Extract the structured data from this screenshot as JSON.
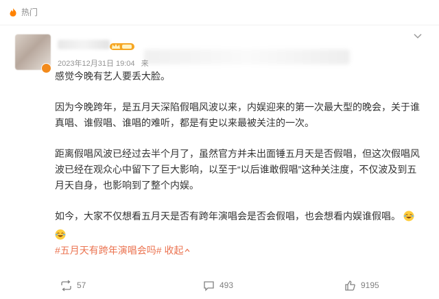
{
  "header": {
    "section_label": "热门"
  },
  "post": {
    "timestamp": "2023年12月31日 19:04",
    "source_prefix": "来",
    "paragraphs": [
      "感觉今晚有艺人要丢大脸。",
      "因为今晚跨年，是五月天深陷假唱风波以来，内娱迎来的第一次最大型的晚会，关于谁真唱、谁假唱、谁唱的难听，都是有史以来最被关注的一次。",
      "距离假唱风波已经过去半个月了，虽然官方并未出面锤五月天是否假唱，但这次假唱风波已经在观众心中留下了巨大影响，以至于“以后谁敢假唱”这种关注度，不仅波及到五月天自身，也影响到了整个内娱。",
      "如今，大家不仅想看五月天是否有跨年演唱会是否会假唱，也会想看内娱谁假唱。"
    ],
    "hashtag": "#五月天有跨年演唱会吗#",
    "collapse_label": "收起"
  },
  "actions": {
    "repost_count": "57",
    "comment_count": "493",
    "like_count": "9195"
  },
  "colors": {
    "link": "#eb7350",
    "muted": "#939393",
    "text": "#333333"
  }
}
